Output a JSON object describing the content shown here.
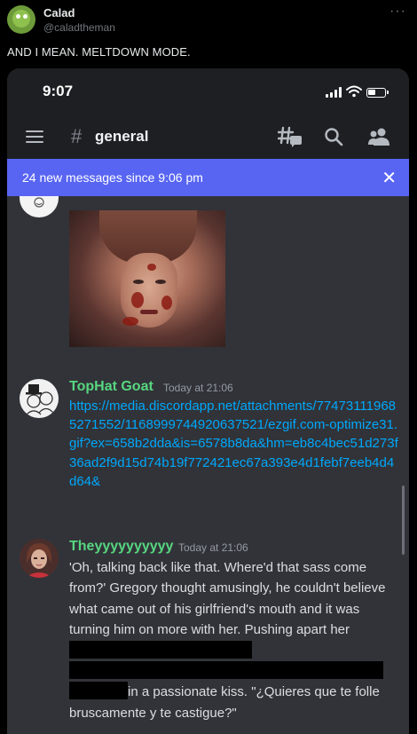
{
  "tweet": {
    "display_name": "Calad",
    "handle": "@caladtheman",
    "more_icon": "more-horizontal-icon",
    "text": "AND I MEAN. MELTDOWN MODE."
  },
  "phone": {
    "status_bar": {
      "time": "9:07",
      "icons": [
        "signal-icon",
        "wifi-icon",
        "battery-icon"
      ]
    },
    "app_bar": {
      "hash": "#",
      "channel": "general",
      "icons": [
        "menu-icon",
        "threads-icon",
        "search-icon",
        "members-icon"
      ]
    },
    "banner": {
      "text": "24 new messages since 9:06 pm",
      "close": "✕",
      "color": "#5865f2"
    },
    "messages": [
      {
        "username": "TopHat Goat",
        "timestamp": "Today at 21:06",
        "link": "https://media.discordapp.net/attachments/774731119685271552/1168999744920637521/ezgif.com-optimize31.gif?ex=658b2dda&is=6578b8da&hm=eb8c4bec51d273f36ad2f9d15d74b19f772421ec67a393e4d1febf7eeb4d4d64&"
      },
      {
        "username": "Theyyyyyyyyyy",
        "timestamp": "Today at 21:06",
        "text_part1": "'Oh, talking back like that. Where'd that sass come from?' Gregory thought amusingly, he couldn't believe what came out of his girlfriend's mouth and it was turning him on more with her. Pushing apart her",
        "text_part2": "in a passionate kiss. \"¿Quieres que te folle bruscamente y te castigue?\""
      }
    ],
    "colors": {
      "chat_bg": "#313338",
      "header_bg": "#1e1f22",
      "username": "#57d680",
      "link": "#00a8fc"
    }
  }
}
